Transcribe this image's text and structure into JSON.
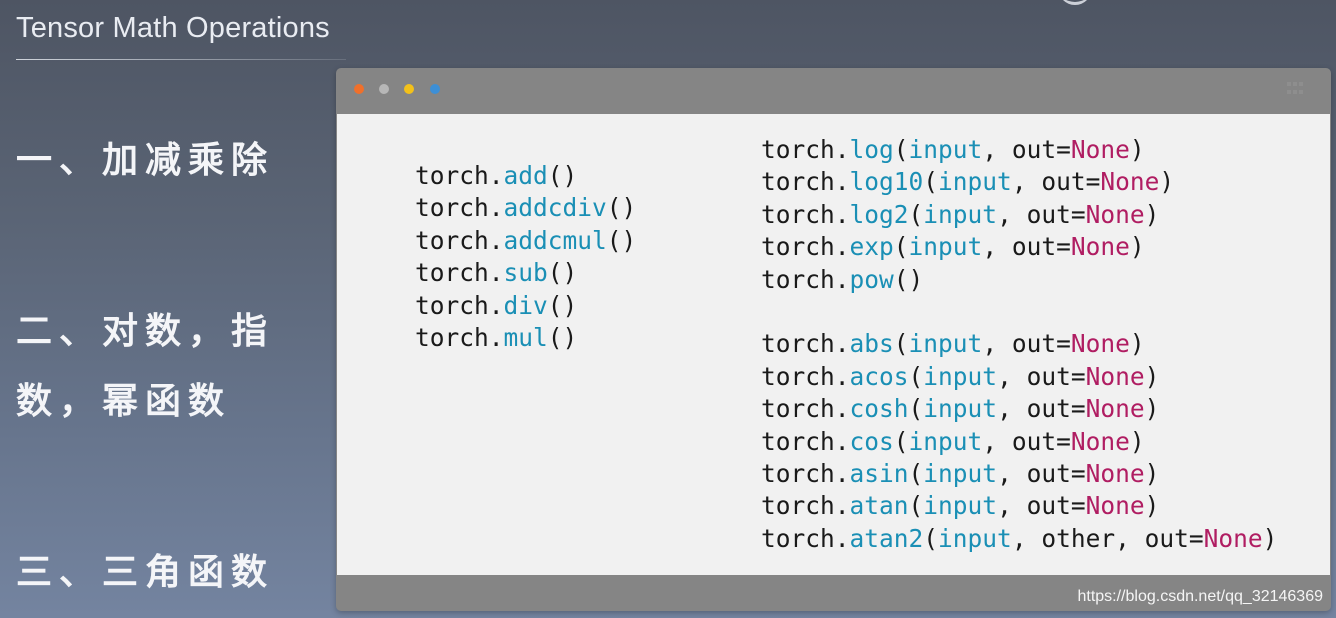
{
  "slide": {
    "title": "Tensor Math Operations"
  },
  "sections": [
    {
      "label": "一、加减乘除"
    },
    {
      "label": "二、对数，指数，幂函数"
    },
    {
      "label": "三、三角函数"
    }
  ],
  "window": {
    "dots": [
      "#f0702b",
      "#b7b7b7",
      "#f3c11a",
      "#3d8fd6"
    ]
  },
  "code": {
    "left_column": [
      [
        {
          "t": "torch.",
          "c": "txt"
        },
        {
          "t": "add",
          "c": "fn"
        },
        {
          "t": "()",
          "c": "txt"
        }
      ],
      [
        {
          "t": "torch.",
          "c": "txt"
        },
        {
          "t": "addcdiv",
          "c": "fn"
        },
        {
          "t": "()",
          "c": "txt"
        }
      ],
      [
        {
          "t": "torch.",
          "c": "txt"
        },
        {
          "t": "addcmul",
          "c": "fn"
        },
        {
          "t": "()",
          "c": "txt"
        }
      ],
      [
        {
          "t": "torch.",
          "c": "txt"
        },
        {
          "t": "sub",
          "c": "fn"
        },
        {
          "t": "()",
          "c": "txt"
        }
      ],
      [
        {
          "t": "torch.",
          "c": "txt"
        },
        {
          "t": "div",
          "c": "fn"
        },
        {
          "t": "()",
          "c": "txt"
        }
      ],
      [
        {
          "t": "torch.",
          "c": "txt"
        },
        {
          "t": "mul",
          "c": "fn"
        },
        {
          "t": "()",
          "c": "txt"
        }
      ]
    ],
    "right_column": [
      [
        {
          "t": "torch.",
          "c": "txt"
        },
        {
          "t": "log",
          "c": "fn"
        },
        {
          "t": "(",
          "c": "txt"
        },
        {
          "t": "input",
          "c": "fn"
        },
        {
          "t": ", out=",
          "c": "txt"
        },
        {
          "t": "None",
          "c": "kw"
        },
        {
          "t": ")",
          "c": "txt"
        }
      ],
      [
        {
          "t": "torch.",
          "c": "txt"
        },
        {
          "t": "log10",
          "c": "fn"
        },
        {
          "t": "(",
          "c": "txt"
        },
        {
          "t": "input",
          "c": "fn"
        },
        {
          "t": ", out=",
          "c": "txt"
        },
        {
          "t": "None",
          "c": "kw"
        },
        {
          "t": ")",
          "c": "txt"
        }
      ],
      [
        {
          "t": "torch.",
          "c": "txt"
        },
        {
          "t": "log2",
          "c": "fn"
        },
        {
          "t": "(",
          "c": "txt"
        },
        {
          "t": "input",
          "c": "fn"
        },
        {
          "t": ", out=",
          "c": "txt"
        },
        {
          "t": "None",
          "c": "kw"
        },
        {
          "t": ")",
          "c": "txt"
        }
      ],
      [
        {
          "t": "torch.",
          "c": "txt"
        },
        {
          "t": "exp",
          "c": "fn"
        },
        {
          "t": "(",
          "c": "txt"
        },
        {
          "t": "input",
          "c": "fn"
        },
        {
          "t": ", out=",
          "c": "txt"
        },
        {
          "t": "None",
          "c": "kw"
        },
        {
          "t": ")",
          "c": "txt"
        }
      ],
      [
        {
          "t": "torch.",
          "c": "txt"
        },
        {
          "t": "pow",
          "c": "fn"
        },
        {
          "t": "()",
          "c": "txt"
        }
      ],
      [],
      [
        {
          "t": "torch.",
          "c": "txt"
        },
        {
          "t": "abs",
          "c": "fn"
        },
        {
          "t": "(",
          "c": "txt"
        },
        {
          "t": "input",
          "c": "fn"
        },
        {
          "t": ", out=",
          "c": "txt"
        },
        {
          "t": "None",
          "c": "kw"
        },
        {
          "t": ")",
          "c": "txt"
        }
      ],
      [
        {
          "t": "torch.",
          "c": "txt"
        },
        {
          "t": "acos",
          "c": "fn"
        },
        {
          "t": "(",
          "c": "txt"
        },
        {
          "t": "input",
          "c": "fn"
        },
        {
          "t": ", out=",
          "c": "txt"
        },
        {
          "t": "None",
          "c": "kw"
        },
        {
          "t": ")",
          "c": "txt"
        }
      ],
      [
        {
          "t": "torch.",
          "c": "txt"
        },
        {
          "t": "cosh",
          "c": "fn"
        },
        {
          "t": "(",
          "c": "txt"
        },
        {
          "t": "input",
          "c": "fn"
        },
        {
          "t": ", out=",
          "c": "txt"
        },
        {
          "t": "None",
          "c": "kw"
        },
        {
          "t": ")",
          "c": "txt"
        }
      ],
      [
        {
          "t": "torch.",
          "c": "txt"
        },
        {
          "t": "cos",
          "c": "fn"
        },
        {
          "t": "(",
          "c": "txt"
        },
        {
          "t": "input",
          "c": "fn"
        },
        {
          "t": ", out=",
          "c": "txt"
        },
        {
          "t": "None",
          "c": "kw"
        },
        {
          "t": ")",
          "c": "txt"
        }
      ],
      [
        {
          "t": "torch.",
          "c": "txt"
        },
        {
          "t": "asin",
          "c": "fn"
        },
        {
          "t": "(",
          "c": "txt"
        },
        {
          "t": "input",
          "c": "fn"
        },
        {
          "t": ", out=",
          "c": "txt"
        },
        {
          "t": "None",
          "c": "kw"
        },
        {
          "t": ")",
          "c": "txt"
        }
      ],
      [
        {
          "t": "torch.",
          "c": "txt"
        },
        {
          "t": "atan",
          "c": "fn"
        },
        {
          "t": "(",
          "c": "txt"
        },
        {
          "t": "input",
          "c": "fn"
        },
        {
          "t": ", out=",
          "c": "txt"
        },
        {
          "t": "None",
          "c": "kw"
        },
        {
          "t": ")",
          "c": "txt"
        }
      ],
      [
        {
          "t": "torch.",
          "c": "txt"
        },
        {
          "t": "atan2",
          "c": "fn"
        },
        {
          "t": "(",
          "c": "txt"
        },
        {
          "t": "input",
          "c": "fn"
        },
        {
          "t": ", other, out=",
          "c": "txt"
        },
        {
          "t": "None",
          "c": "kw"
        },
        {
          "t": ")",
          "c": "txt"
        }
      ]
    ]
  },
  "watermark": "https://blog.csdn.net/qq_32146369"
}
